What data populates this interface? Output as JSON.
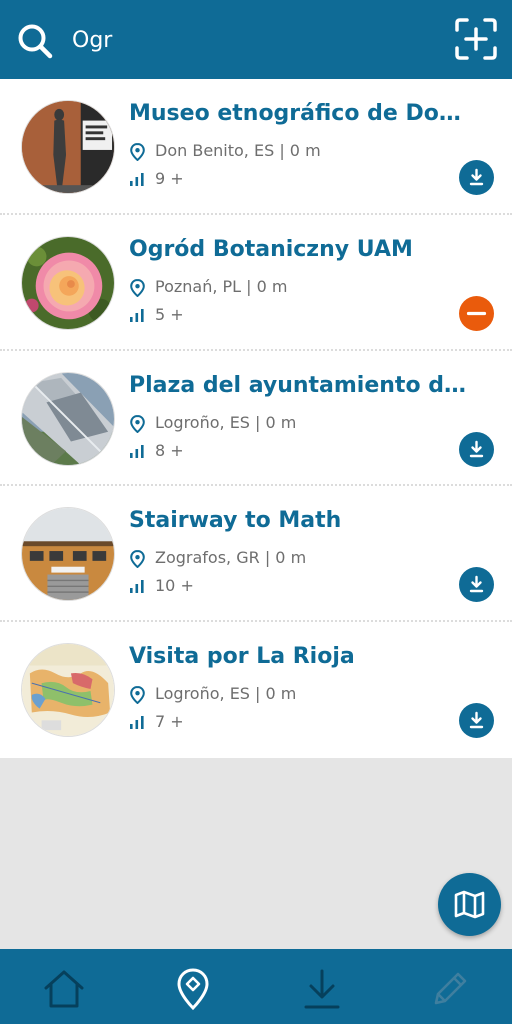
{
  "search": {
    "query": "Ogr"
  },
  "colors": {
    "primary": "#0f6b96",
    "remove": "#ea5b0c",
    "muted": "#6e6e6e",
    "background": "#e5e5e5"
  },
  "icons": {
    "search": "search-icon",
    "scan": "qr-scan-icon",
    "location": "location-pin-icon",
    "stats": "bar-chart-icon",
    "download": "download-icon",
    "remove": "remove-icon",
    "map": "map-icon"
  },
  "items": [
    {
      "title": "Museo etnográfico de Don Benito",
      "location": "Don Benito, ES | 0 m",
      "count": "9 +",
      "action": "download"
    },
    {
      "title": "Ogród Botaniczny UAM",
      "location": "Poznań, PL | 0 m",
      "count": "5 +",
      "action": "remove"
    },
    {
      "title": "Plaza del ayuntamiento de Logroño",
      "location": "Logroño, ES | 0 m",
      "count": "8 +",
      "action": "download"
    },
    {
      "title": "Stairway to Math",
      "location": "Zografos, GR | 0 m",
      "count": "10 +",
      "action": "download"
    },
    {
      "title": "Visita por La Rioja",
      "location": "Logroño, ES | 0 m",
      "count": "7 +",
      "action": "download"
    }
  ],
  "bottom_nav": [
    {
      "name": "home",
      "icon": "home-icon"
    },
    {
      "name": "nearby",
      "icon": "location-pin-icon",
      "active": true
    },
    {
      "name": "downloads",
      "icon": "download-icon"
    },
    {
      "name": "edit",
      "icon": "pencil-icon",
      "disabled": true
    }
  ]
}
